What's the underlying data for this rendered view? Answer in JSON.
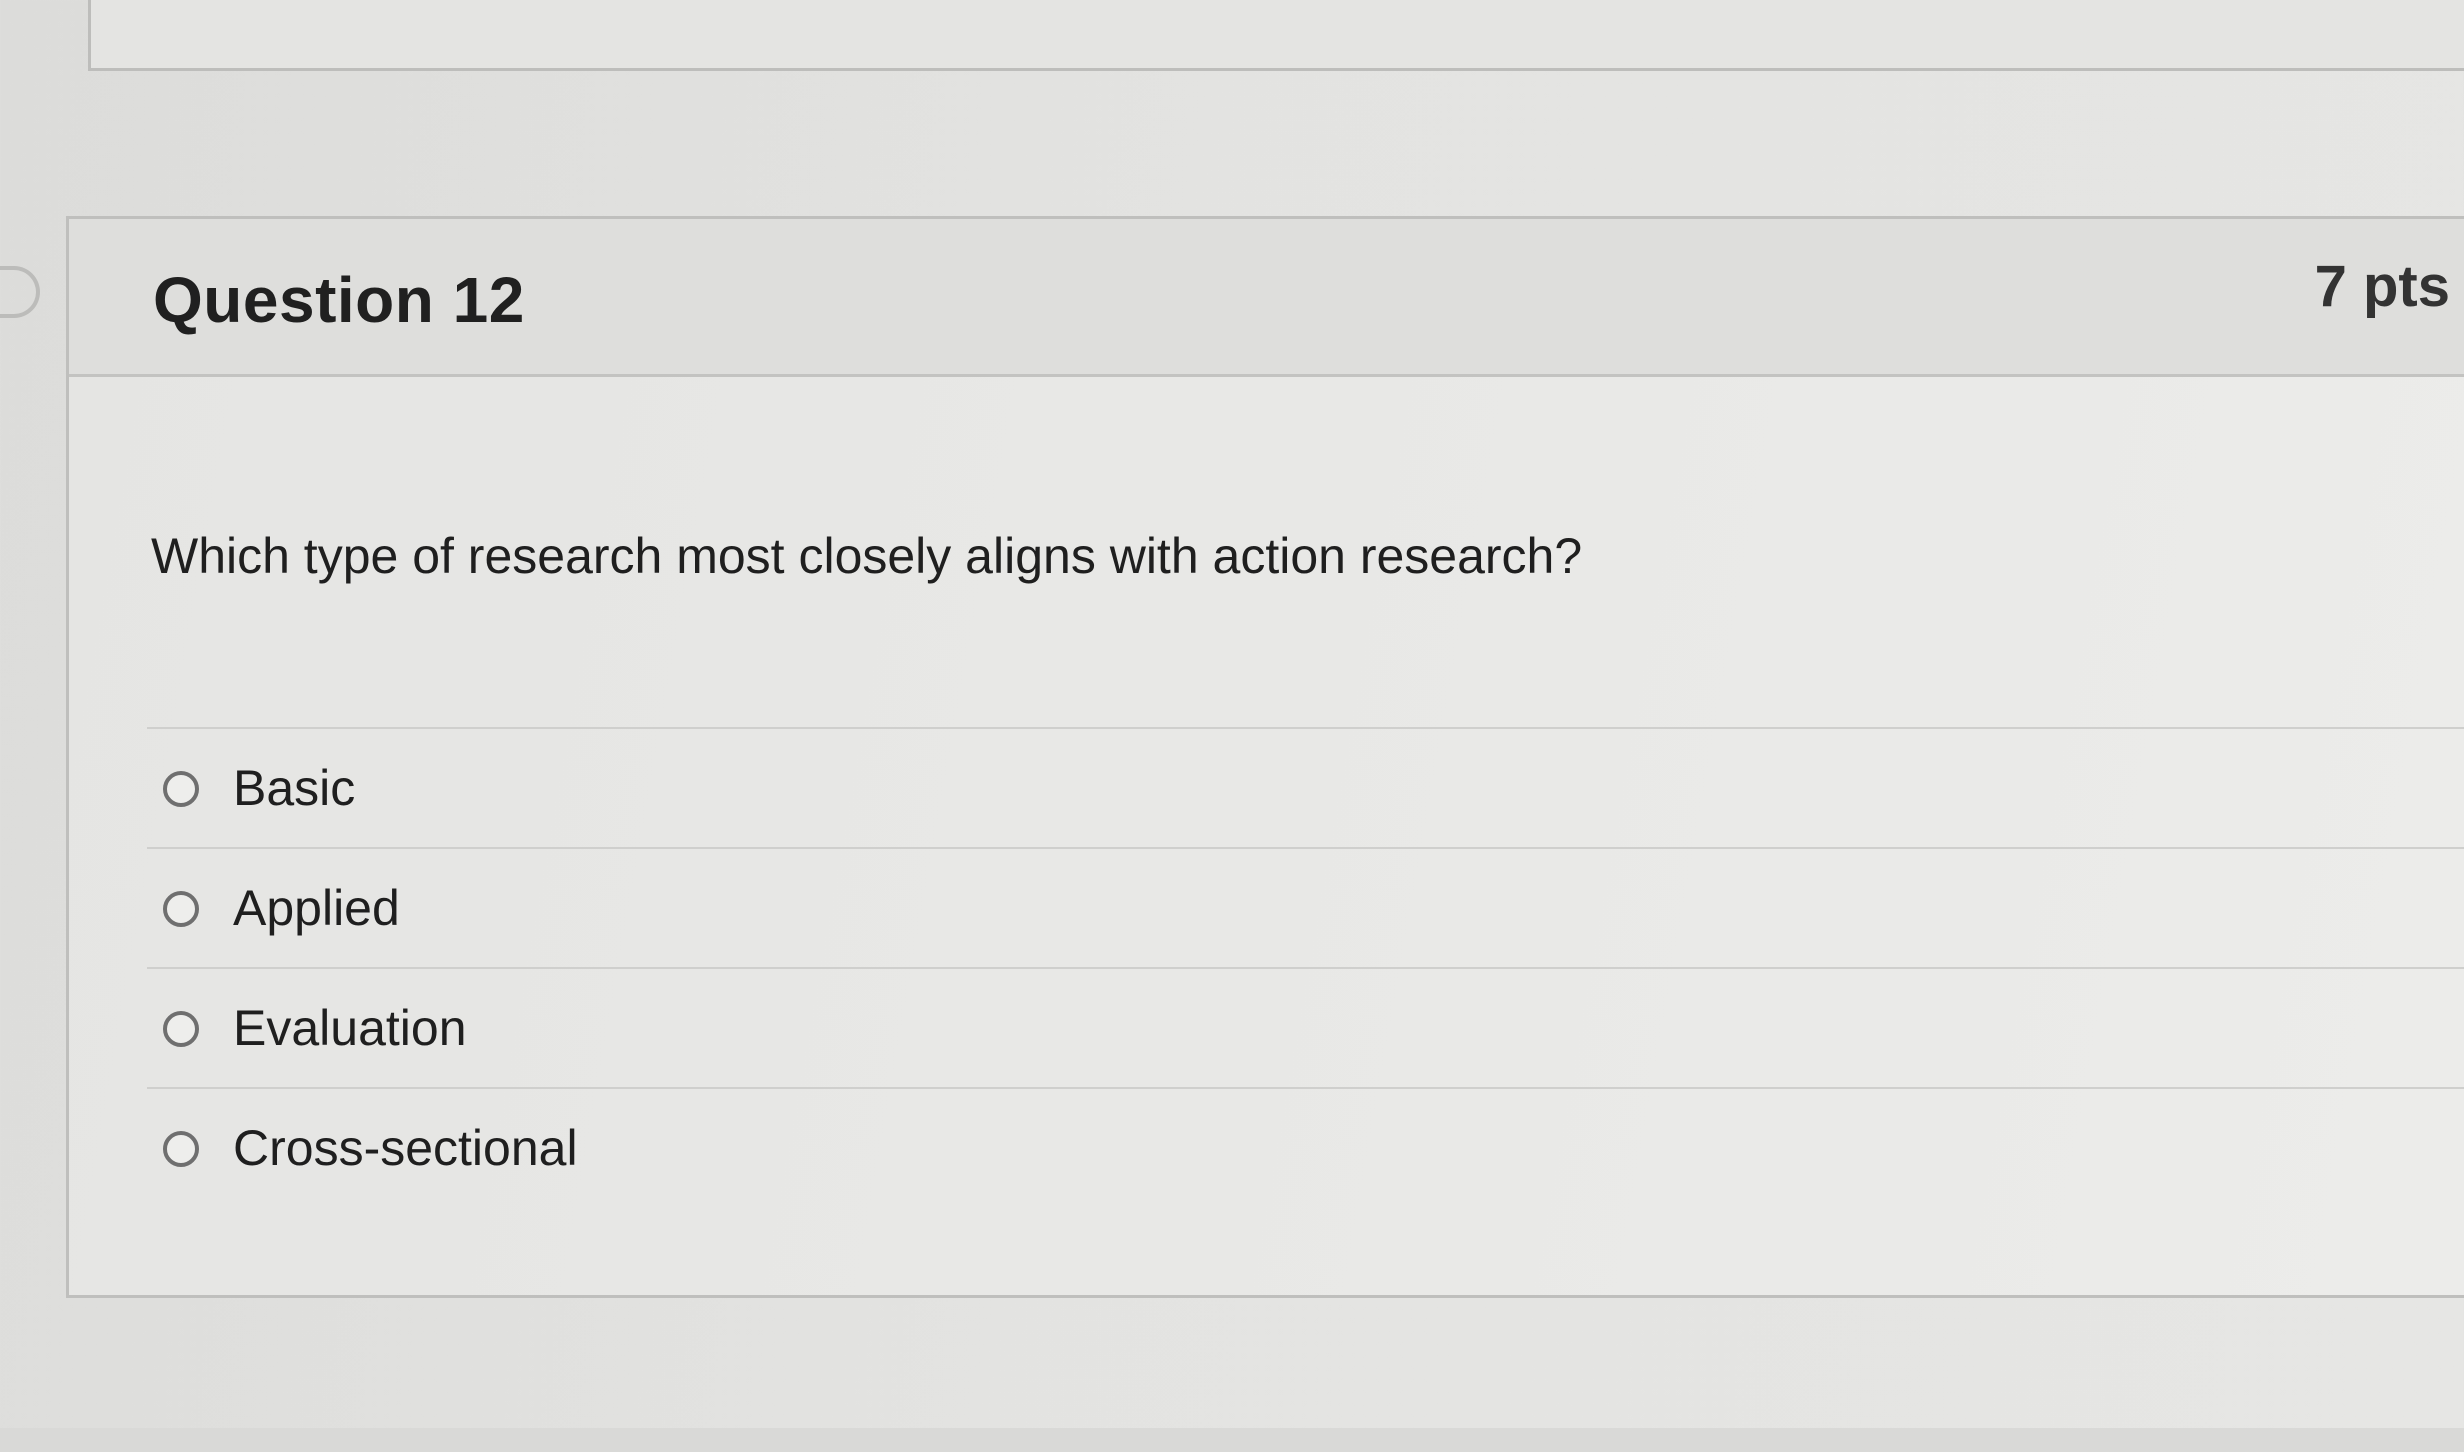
{
  "question": {
    "title": "Question 12",
    "points": "7 pts",
    "prompt": "Which type of research most closely aligns with action research?",
    "options": [
      {
        "label": "Basic",
        "selected": false
      },
      {
        "label": "Applied",
        "selected": false
      },
      {
        "label": "Evaluation",
        "selected": false
      },
      {
        "label": "Cross-sectional",
        "selected": false
      }
    ]
  }
}
